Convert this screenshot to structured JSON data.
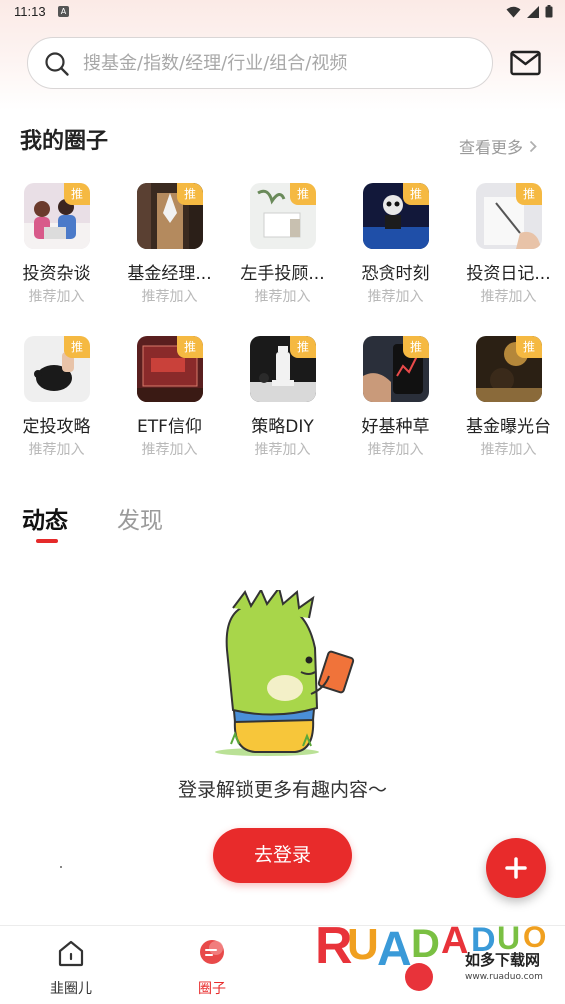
{
  "status_bar": {
    "time": "11:13",
    "notif_letter": "A"
  },
  "search": {
    "placeholder": "搜基金/指数/经理/行业/组合/视频"
  },
  "my_circles": {
    "title": "我的圈子",
    "see_more": "查看更多",
    "badge": "推",
    "items": [
      {
        "name": "投资杂谈",
        "sub": "推荐加入"
      },
      {
        "name": "基金经理...",
        "sub": "推荐加入"
      },
      {
        "name": "左手投顾...",
        "sub": "推荐加入"
      },
      {
        "name": "恐贪时刻",
        "sub": "推荐加入"
      },
      {
        "name": "投资日记...",
        "sub": "推荐加入"
      },
      {
        "name": "定投攻略",
        "sub": "推荐加入"
      },
      {
        "name": "ETF信仰",
        "sub": "推荐加入"
      },
      {
        "name": "策略DIY",
        "sub": "推荐加入"
      },
      {
        "name": "好基种草",
        "sub": "推荐加入"
      },
      {
        "name": "基金曝光台",
        "sub": "推荐加入"
      }
    ]
  },
  "tabs": [
    {
      "label": "动态",
      "active": true
    },
    {
      "label": "发现",
      "active": false
    }
  ],
  "empty_state": {
    "text": "登录解锁更多有趣内容～",
    "button": "去登录"
  },
  "bottom_nav": [
    {
      "label": "韭圈儿",
      "active": false
    },
    {
      "label": "圈子",
      "active": true
    }
  ],
  "watermark": {
    "brand": "RUADADUO",
    "cn": "如多下载网",
    "url": "www.ruaduo.com"
  },
  "colors": {
    "accent": "#e82b2b",
    "badge": "#f5b942",
    "muted": "#b9b9b9"
  }
}
